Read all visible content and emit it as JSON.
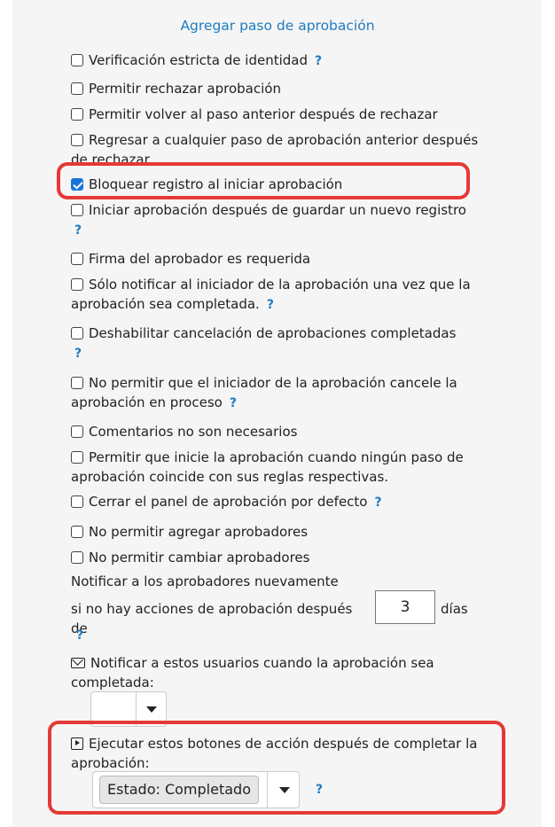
{
  "title_link": "Agregar paso de aprobación",
  "help_mark": "?",
  "options": [
    {
      "label": "Verificación estricta de identidad",
      "checked": false
    },
    {
      "label": "Permitir rechazar aprobación",
      "checked": false
    },
    {
      "label": "Permitir volver al paso anterior después de rechazar",
      "checked": false
    },
    {
      "label": "Regresar a cualquier paso de aprobación anterior después de rechazar",
      "checked": false
    },
    {
      "label": "Bloquear registro al iniciar aprobación",
      "checked": true
    },
    {
      "label": "Iniciar aprobación después de guardar un nuevo registro",
      "checked": false
    },
    {
      "label": "Firma del aprobador es requerida",
      "checked": false
    },
    {
      "label": "Sólo notificar al iniciador de la aprobación una vez que la aprobación sea completada.",
      "checked": false
    },
    {
      "label": "Deshabilitar cancelación de aprobaciones completadas",
      "checked": false
    },
    {
      "label": "No permitir que el iniciador de la aprobación cancele la aprobación en proceso",
      "checked": false
    },
    {
      "label": "Comentarios no son necesarios",
      "checked": false
    },
    {
      "label": "Permitir que inicie la aprobación cuando ningún paso de aprobación coincide con sus reglas respectivas.",
      "checked": false
    },
    {
      "label": "Cerrar el panel de aprobación por defecto",
      "checked": false
    },
    {
      "label": "No permitir agregar aprobadores",
      "checked": false
    },
    {
      "label": "No permitir cambiar aprobadores",
      "checked": false
    }
  ],
  "renotify": {
    "line1": "Notificar a los aprobadores nuevamente",
    "line2": "si no hay acciones de aprobación después de",
    "days_value": "3",
    "days_unit": "días"
  },
  "notify_users": {
    "icon": "envelope-icon",
    "label": "Notificar a estos usuarios cuando la aprobación sea completada:"
  },
  "action_buttons": {
    "icon": "play-square-icon",
    "label": "Ejecutar estos botones de acción después de completar la aprobación:",
    "selected": "Estado: Completado"
  },
  "colors": {
    "accent": "#1f7bbf",
    "highlight": "#e53935",
    "checkbox": "#1a73d9"
  }
}
